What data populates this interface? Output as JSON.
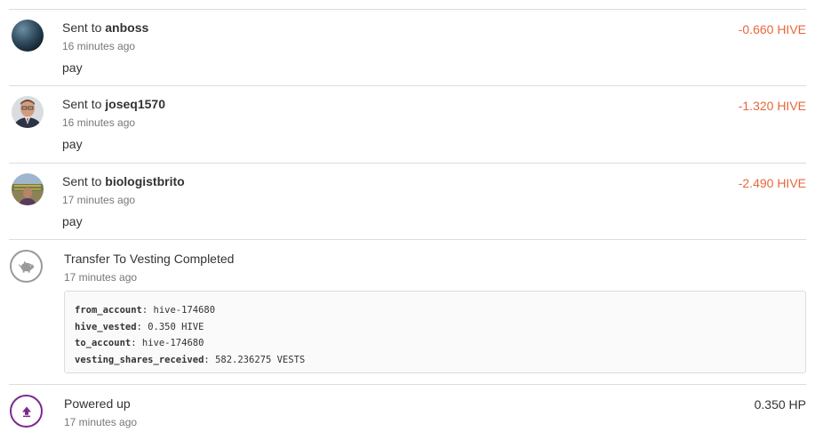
{
  "transactions": [
    {
      "prefix": "Sent to",
      "account": "anboss",
      "time": "16 minutes ago",
      "memo": "pay",
      "amount": "-0.660 HIVE"
    },
    {
      "prefix": "Sent to",
      "account": "joseq1570",
      "time": "16 minutes ago",
      "memo": "pay",
      "amount": "-1.320 HIVE"
    },
    {
      "prefix": "Sent to",
      "account": "biologistbrito",
      "time": "17 minutes ago",
      "memo": "pay",
      "amount": "-2.490 HIVE"
    }
  ],
  "vesting": {
    "title": "Transfer To Vesting Completed",
    "time": "17 minutes ago",
    "fields": [
      {
        "key": "from_account",
        "value": "hive-174680"
      },
      {
        "key": "hive_vested",
        "value": "0.350 HIVE"
      },
      {
        "key": "to_account",
        "value": "hive-174680"
      },
      {
        "key": "vesting_shares_received",
        "value": "582.236275 VESTS"
      }
    ]
  },
  "power_up": {
    "title": "Powered up",
    "time": "17 minutes ago",
    "amount": "0.350 HP"
  },
  "colors": {
    "negative_amount": "#e8673c",
    "power_up_accent": "#7b2a8f",
    "divider": "#dcdcdc"
  },
  "icons": {
    "vesting": "piggy-bank-icon",
    "power_up": "arrow-up-icon"
  }
}
